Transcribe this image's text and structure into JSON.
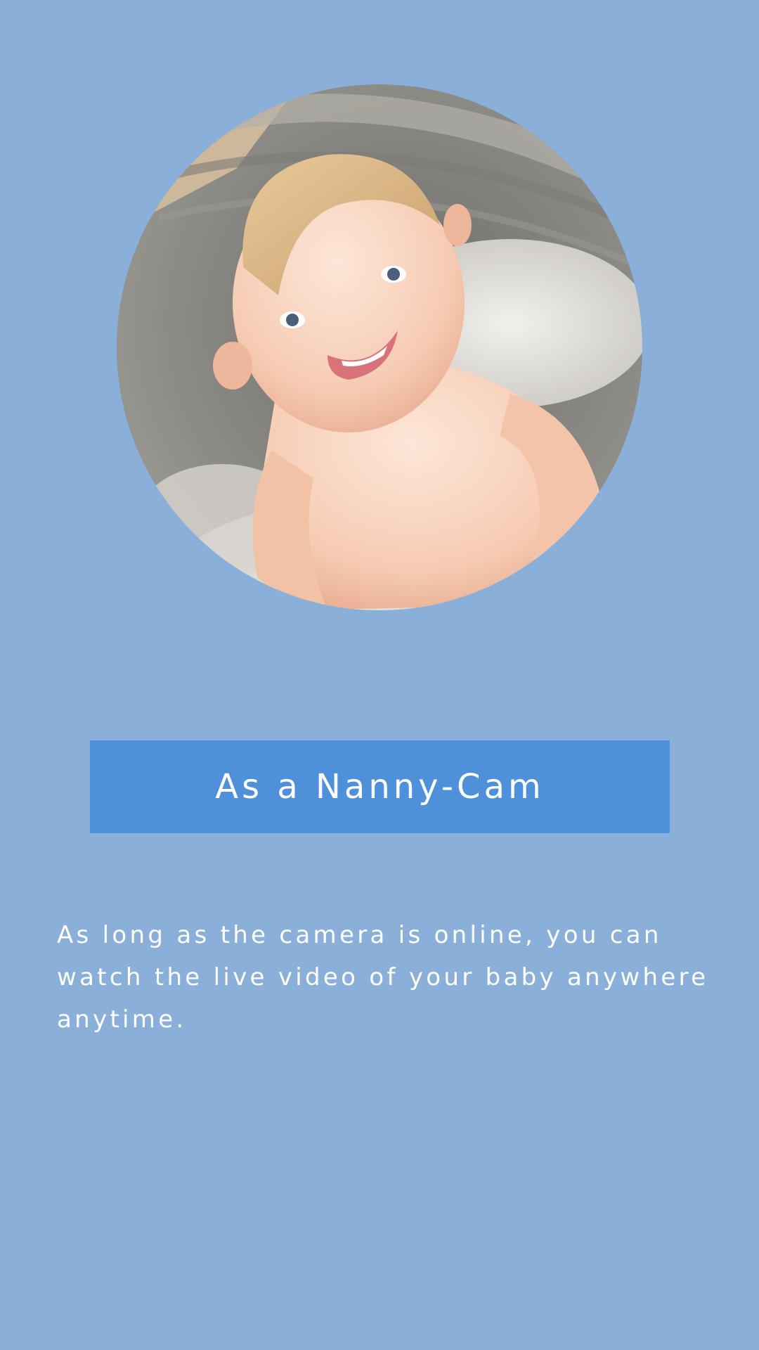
{
  "screen": {
    "background_color": "#8aafd9"
  },
  "hero_image": {
    "subject": "smiling-baby-in-bath-tub-photo"
  },
  "title": {
    "text": "As a Nanny-Cam",
    "background_color": "#4e90d9",
    "text_color": "#ffffff"
  },
  "description": {
    "text": "As long as the camera is online, you can watch the live video of your baby anywhere anytime.",
    "text_color": "#ffffff"
  }
}
